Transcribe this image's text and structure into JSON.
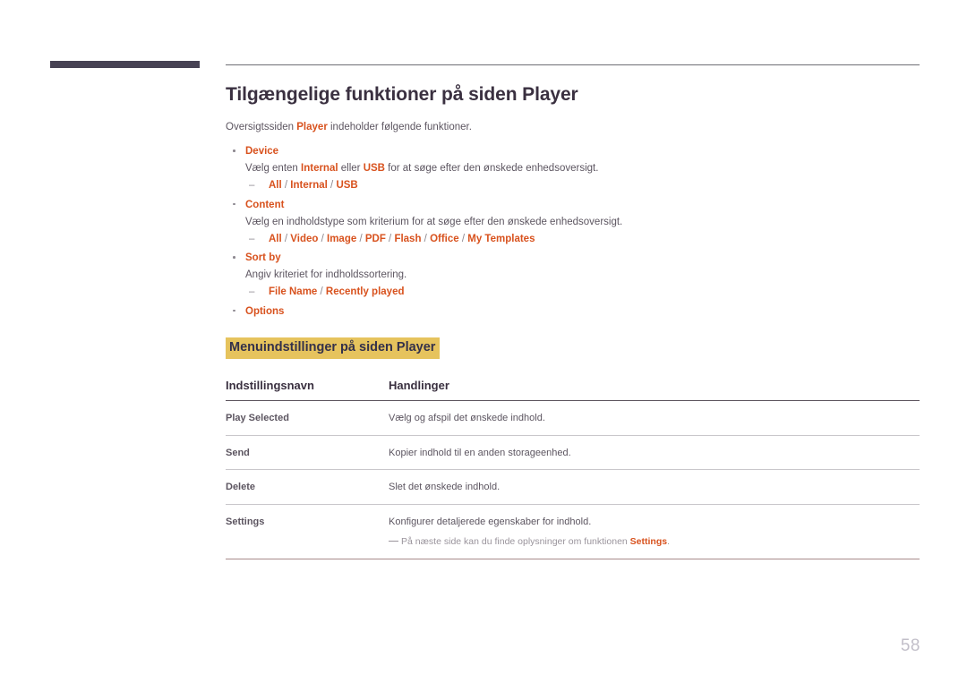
{
  "page": {
    "number": "58",
    "language": "da"
  },
  "header": {
    "title": "Tilgængelige funktioner på siden Player",
    "intro_prefix": "Oversigtssiden ",
    "intro_accent": "Player",
    "intro_suffix": " indeholder følgende funktioner."
  },
  "bullets": [
    {
      "title": "Device",
      "desc_parts": [
        {
          "text": "Vælg enten ",
          "accent": false
        },
        {
          "text": "Internal",
          "accent": true
        },
        {
          "text": " eller ",
          "accent": false
        },
        {
          "text": "USB",
          "accent": true
        },
        {
          "text": " for at søge efter den ønskede enhedsoversigt.",
          "accent": false
        }
      ],
      "options": [
        "All",
        "Internal",
        "USB"
      ]
    },
    {
      "title": "Content",
      "desc_parts": [
        {
          "text": "Vælg en indholdstype som kriterium for at søge efter den ønskede enhedsoversigt.",
          "accent": false
        }
      ],
      "options": [
        "All",
        "Video",
        "Image",
        "PDF",
        "Flash",
        "Office",
        "My Templates"
      ]
    },
    {
      "title": "Sort by",
      "desc_parts": [
        {
          "text": "Angiv kriteriet for indholdssortering.",
          "accent": false
        }
      ],
      "options": [
        "File Name",
        "Recently played"
      ]
    },
    {
      "title": "Options",
      "desc_parts": [],
      "options": []
    }
  ],
  "section": {
    "heading": "Menuindstillinger på siden Player"
  },
  "table": {
    "columns": [
      "Indstillingsnavn",
      "Handlinger"
    ],
    "rows": [
      {
        "term": "Play Selected",
        "action": "Vælg og afspil det ønskede indhold.",
        "note": null
      },
      {
        "term": "Send",
        "action": "Kopier indhold til en anden storageenhed.",
        "note": null
      },
      {
        "term": "Delete",
        "action": "Slet det ønskede indhold.",
        "note": null
      },
      {
        "term": "Settings",
        "action": "Konfigurer detaljerede egenskaber for indhold.",
        "note": {
          "prefix": "På næste side kan du finde oplysninger om funktionen ",
          "accent": "Settings",
          "suffix": "."
        }
      }
    ]
  },
  "colors": {
    "accent_orange": "#d8521e",
    "highlight_gold": "#e6c35d",
    "heading_navy": "#33304a",
    "corner_bar": "#474254",
    "body_text": "#5c5560",
    "page_number": "#c2bfc9"
  }
}
